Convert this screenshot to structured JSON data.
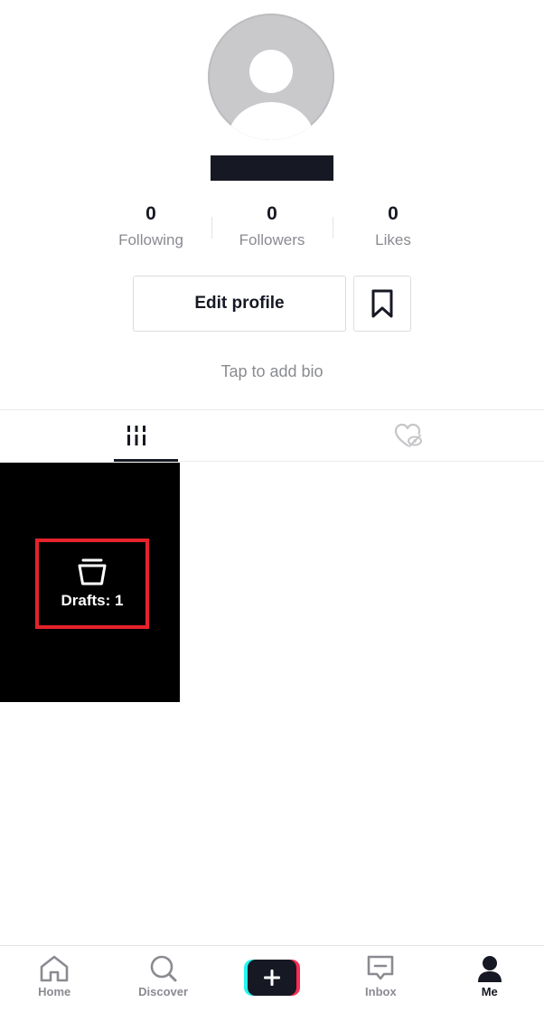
{
  "profile": {
    "bio_prompt": "Tap to add bio"
  },
  "stats": [
    {
      "value": "0",
      "label": "Following"
    },
    {
      "value": "0",
      "label": "Followers"
    },
    {
      "value": "0",
      "label": "Likes"
    }
  ],
  "actions": {
    "edit_profile_label": "Edit profile"
  },
  "tabs": [
    {
      "icon": "grid-icon",
      "active": true
    },
    {
      "icon": "liked-hidden-icon",
      "active": false
    }
  ],
  "drafts": {
    "label": "Drafts: 1",
    "icon": "drafts-icon",
    "highlight_color": "#e5222b"
  },
  "bottom_nav": [
    {
      "label": "Home",
      "icon": "home-icon"
    },
    {
      "label": "Discover",
      "icon": "search-icon"
    },
    {
      "label": "",
      "icon": "plus-icon"
    },
    {
      "label": "Inbox",
      "icon": "inbox-icon"
    },
    {
      "label": "Me",
      "icon": "profile-icon"
    }
  ],
  "colors": {
    "text": "#161823",
    "secondary_text": "#8a8b91",
    "create_cyan": "#25f4ee",
    "create_pink": "#fe2c55"
  }
}
